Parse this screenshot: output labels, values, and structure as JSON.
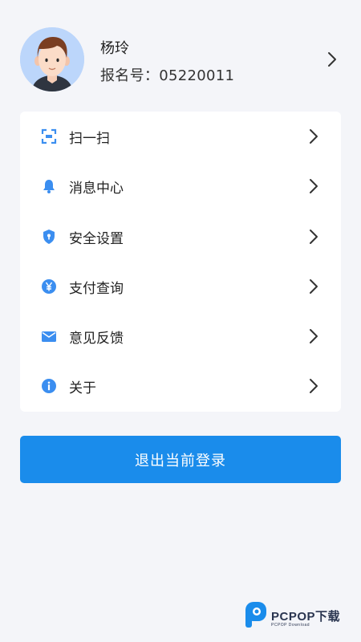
{
  "profile": {
    "name": "杨玲",
    "registration": "报名号：05220011",
    "avatar_icon": "user-avatar"
  },
  "menu": {
    "items": [
      {
        "label": "扫一扫",
        "icon": "scan-icon"
      },
      {
        "label": "消息中心",
        "icon": "bell-icon"
      },
      {
        "label": "安全设置",
        "icon": "shield-icon"
      },
      {
        "label": "支付查询",
        "icon": "yen-icon"
      },
      {
        "label": "意见反馈",
        "icon": "mail-icon"
      },
      {
        "label": "关于",
        "icon": "info-icon"
      }
    ]
  },
  "logout": {
    "label": "退出当前登录"
  },
  "watermark": {
    "brand": "PCPOP下载",
    "sub": "PCPOP Download"
  },
  "colors": {
    "accent": "#1a8ceb",
    "icon_blue": "#3b8ef0",
    "background": "#f4f5f9",
    "card": "#ffffff"
  }
}
